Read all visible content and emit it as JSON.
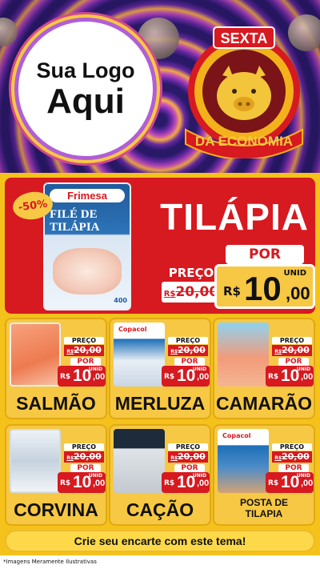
{
  "header": {
    "logo_line1": "Sua Logo",
    "logo_line2": "Aqui",
    "badge_top": "SEXTA",
    "badge_bottom": "DA ECONOMIA"
  },
  "hero": {
    "discount": "-50%",
    "pack_brand": "Frimesa",
    "pack_title_1": "FILÉ DE",
    "pack_title_2": "TILÁPIA",
    "pack_weight": "400",
    "title": "TILÁPIA",
    "por_label": "POR",
    "preco_label": "PREÇO",
    "old_currency": "R$",
    "old_price": "20,00",
    "unid_label": "UNID",
    "currency": "R$",
    "price_int": "10",
    "price_dec": ",00"
  },
  "products": [
    {
      "name": "SALMÃO",
      "preco_label": "PREÇO",
      "old_currency": "R$",
      "old_price": "20,00",
      "por_label": "POR",
      "unid_label": "UNID",
      "currency": "R$",
      "price_int": "10",
      "price_dec": ",00"
    },
    {
      "name": "MERLUZA",
      "brand": "Copacol",
      "preco_label": "PREÇO",
      "old_currency": "R$",
      "old_price": "20,00",
      "por_label": "POR",
      "unid_label": "UNID",
      "currency": "R$",
      "price_int": "10",
      "price_dec": ",00"
    },
    {
      "name": "CAMARÃO",
      "preco_label": "PREÇO",
      "old_currency": "R$",
      "old_price": "20,00",
      "por_label": "POR",
      "unid_label": "UNID",
      "currency": "R$",
      "price_int": "10",
      "price_dec": ",00"
    },
    {
      "name": "CORVINA",
      "preco_label": "PREÇO",
      "old_currency": "R$",
      "old_price": "20,00",
      "por_label": "POR",
      "unid_label": "UNID",
      "currency": "R$",
      "price_int": "10",
      "price_dec": ",00"
    },
    {
      "name": "CAÇÃO",
      "preco_label": "PREÇO",
      "old_currency": "R$",
      "old_price": "20,00",
      "por_label": "POR",
      "unid_label": "UNID",
      "currency": "R$",
      "price_int": "10",
      "price_dec": ",00"
    },
    {
      "name_line1": "POSTA DE",
      "name_line2": "TILAPIA",
      "brand": "Copacol",
      "preco_label": "PREÇO",
      "old_currency": "R$",
      "old_price": "20,00",
      "por_label": "POR",
      "unid_label": "UNID",
      "currency": "R$",
      "price_int": "10",
      "price_dec": ",00"
    }
  ],
  "cta": "Crie seu encarte com este tema!",
  "disclaimer": "*Imagens Meramente Ilustrativas",
  "colors": {
    "red": "#d71920",
    "yellow": "#f7c843",
    "purple": "#6a2aa8"
  }
}
